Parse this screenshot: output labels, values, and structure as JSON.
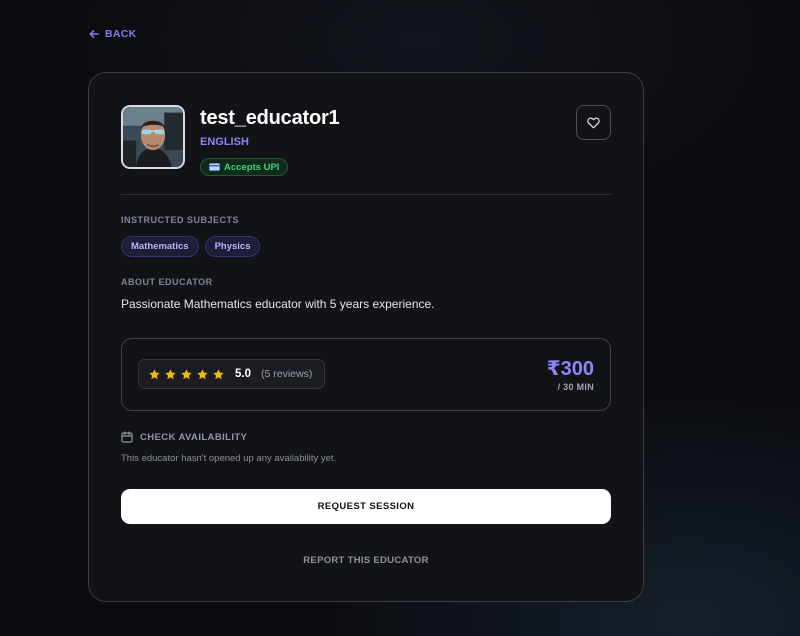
{
  "nav": {
    "back_label": "BACK"
  },
  "educator": {
    "name": "test_educator1",
    "language": "ENGLISH",
    "payment_badge": "Accepts UPI"
  },
  "subjects": {
    "label": "INSTRUCTED SUBJECTS",
    "items": [
      "Mathematics",
      "Physics"
    ]
  },
  "about": {
    "label": "ABOUT EDUCATOR",
    "text": "Passionate Mathematics educator with 5 years experience."
  },
  "rating": {
    "stars": 5,
    "max_stars": 5,
    "value": "5.0",
    "reviews": "(5 reviews)"
  },
  "pricing": {
    "price": "₹300",
    "unit": "/ 30 MIN"
  },
  "availability": {
    "label": "CHECK AVAILABILITY",
    "note": "This educator hasn't opened up any availability yet."
  },
  "actions": {
    "request_label": "REQUEST SESSION",
    "report_label": "REPORT THIS EDUCATOR"
  },
  "colors": {
    "accent": "#8b86f5",
    "star": "#f5b50a",
    "badge_green": "#3fd07a",
    "background": "#0b0c10",
    "card": "#121317"
  },
  "icons": {
    "back": "arrow-left-icon",
    "favorite": "heart-icon",
    "payment": "credit-card-icon",
    "calendar": "calendar-icon",
    "star": "star-icon"
  }
}
